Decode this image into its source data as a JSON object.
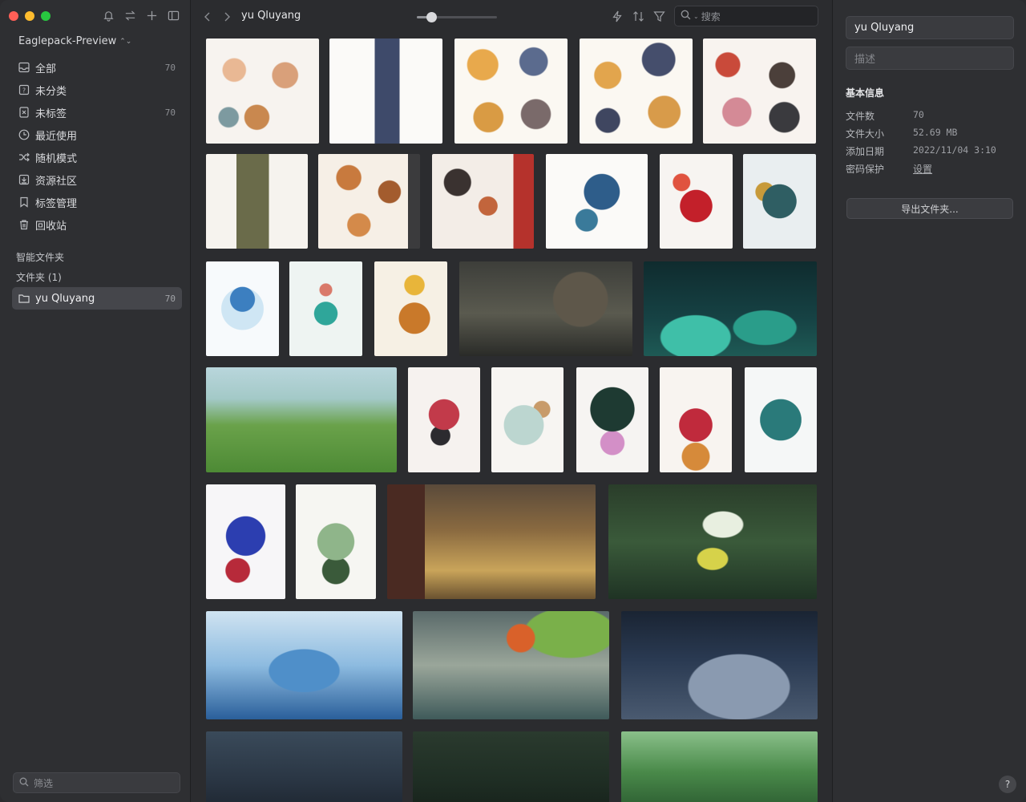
{
  "sidebar": {
    "library_name": "Eaglepack-Preview",
    "items": [
      {
        "label": "全部",
        "count": "70",
        "icon": "inbox-icon"
      },
      {
        "label": "未分类",
        "count": "",
        "icon": "unfiled-icon"
      },
      {
        "label": "未标签",
        "count": "70",
        "icon": "untagged-icon"
      },
      {
        "label": "最近使用",
        "count": "",
        "icon": "clock-icon"
      },
      {
        "label": "随机模式",
        "count": "",
        "icon": "shuffle-icon"
      },
      {
        "label": "资源社区",
        "count": "",
        "icon": "community-icon"
      },
      {
        "label": "标签管理",
        "count": "",
        "icon": "bookmark-icon"
      },
      {
        "label": "回收站",
        "count": "",
        "icon": "trash-icon"
      }
    ],
    "smart_folder_title": "智能文件夹",
    "folder_title": "文件夹 (1)",
    "folder": {
      "label": "yu Qluyang",
      "count": "70"
    },
    "filter_placeholder": "筛选"
  },
  "toolbar": {
    "folder_title": "yu Qluyang",
    "search_placeholder": "搜索",
    "zoom_level": 0.18
  },
  "inspector": {
    "name": "yu Qluyang",
    "description_placeholder": "描述",
    "basic_info_title": "基本信息",
    "rows": [
      {
        "key": "文件数",
        "value": "70"
      },
      {
        "key": "文件大小",
        "value": "52.69 MB"
      },
      {
        "key": "添加日期",
        "value": "2022/11/04 3:10"
      },
      {
        "key": "密码保护",
        "value": "设置"
      }
    ],
    "export_label": "导出文件夹...",
    "help_label": "?"
  }
}
